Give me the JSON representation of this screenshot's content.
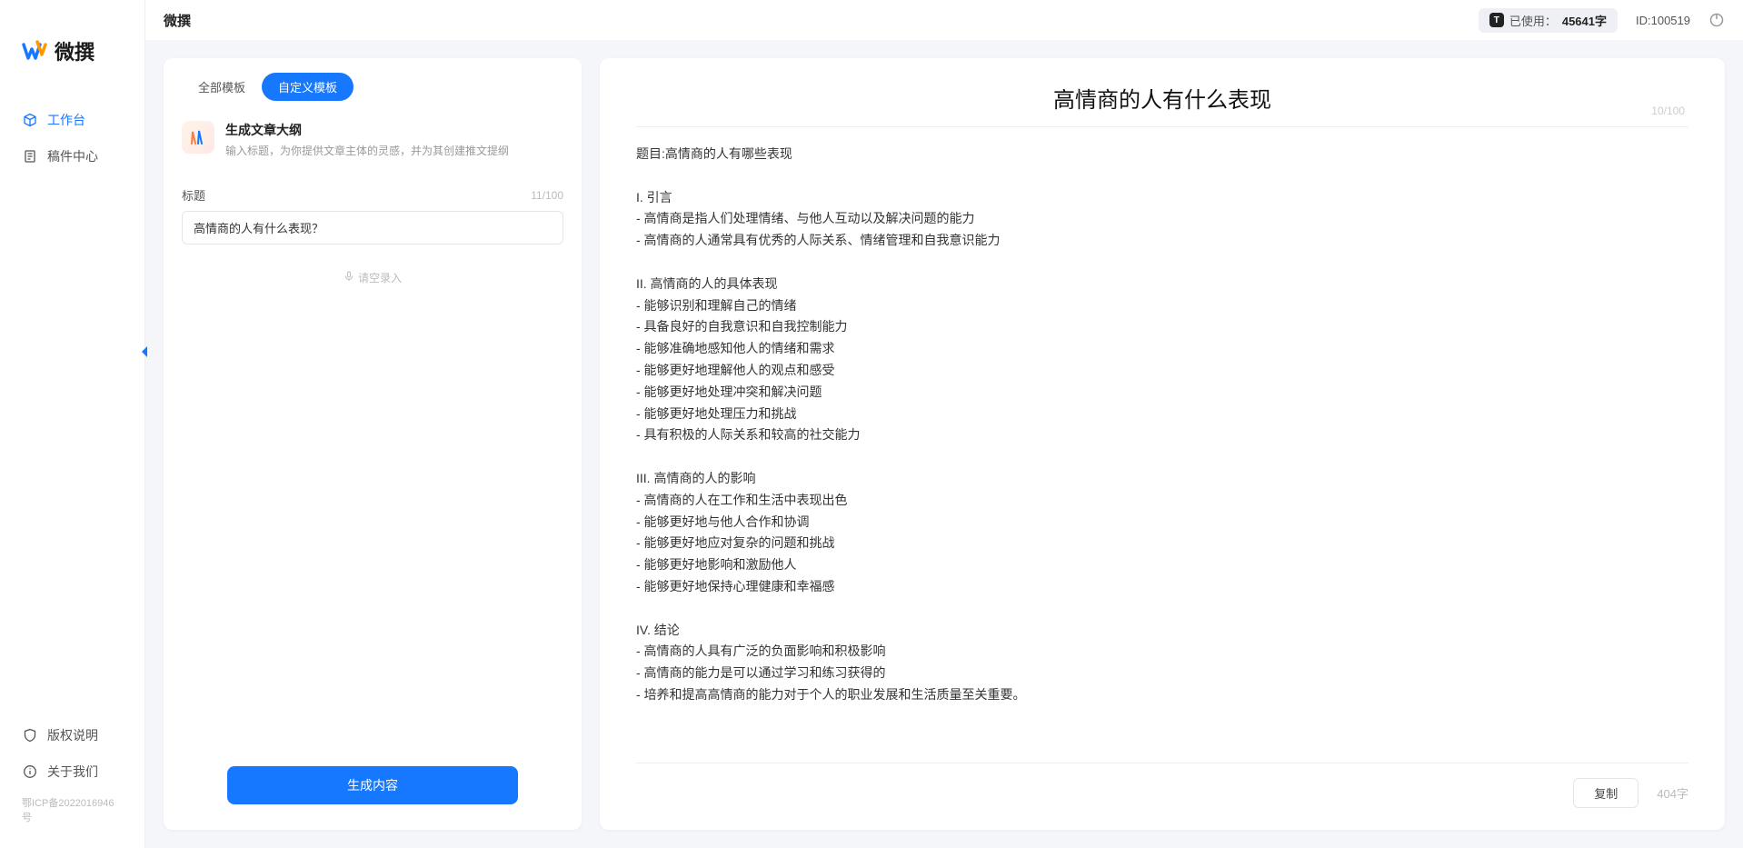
{
  "brand": {
    "name": "微撰"
  },
  "sidebar": {
    "nav": [
      {
        "label": "工作台",
        "icon": "cube-icon",
        "active": true
      },
      {
        "label": "稿件中心",
        "icon": "document-icon",
        "active": false
      }
    ],
    "footer": [
      {
        "label": "版权说明",
        "icon": "shield-icon"
      },
      {
        "label": "关于我们",
        "icon": "info-icon"
      }
    ],
    "icp": "鄂ICP备2022016946号"
  },
  "topbar": {
    "title": "微撰",
    "usage_prefix": "已使用：",
    "usage_value": "45641字",
    "id_label": "ID:100519"
  },
  "left_panel": {
    "tabs": [
      {
        "label": "全部模板",
        "active": false
      },
      {
        "label": "自定义模板",
        "active": true
      }
    ],
    "template": {
      "title": "生成文章大纲",
      "desc": "输入标题，为你提供文章主体的灵感，并为其创建推文提纲"
    },
    "form": {
      "label": "标题",
      "char_count": "11/100",
      "value": "高情商的人有什么表现？"
    },
    "voice_hint": "请空录入",
    "generate_btn": "生成内容"
  },
  "right_panel": {
    "title": "高情商的人有什么表现",
    "title_count": "10/100",
    "body": "题目:高情商的人有哪些表现\n\nI. 引言\n- 高情商是指人们处理情绪、与他人互动以及解决问题的能力\n- 高情商的人通常具有优秀的人际关系、情绪管理和自我意识能力\n\nII. 高情商的人的具体表现\n- 能够识别和理解自己的情绪\n- 具备良好的自我意识和自我控制能力\n- 能够准确地感知他人的情绪和需求\n- 能够更好地理解他人的观点和感受\n- 能够更好地处理冲突和解决问题\n- 能够更好地处理压力和挑战\n- 具有积极的人际关系和较高的社交能力\n\nIII. 高情商的人的影响\n- 高情商的人在工作和生活中表现出色\n- 能够更好地与他人合作和协调\n- 能够更好地应对复杂的问题和挑战\n- 能够更好地影响和激励他人\n- 能够更好地保持心理健康和幸福感\n\nIV. 结论\n- 高情商的人具有广泛的负面影响和积极影响\n- 高情商的能力是可以通过学习和练习获得的\n- 培养和提高高情商的能力对于个人的职业发展和生活质量至关重要。",
    "copy_btn": "复制",
    "word_count": "404字"
  }
}
